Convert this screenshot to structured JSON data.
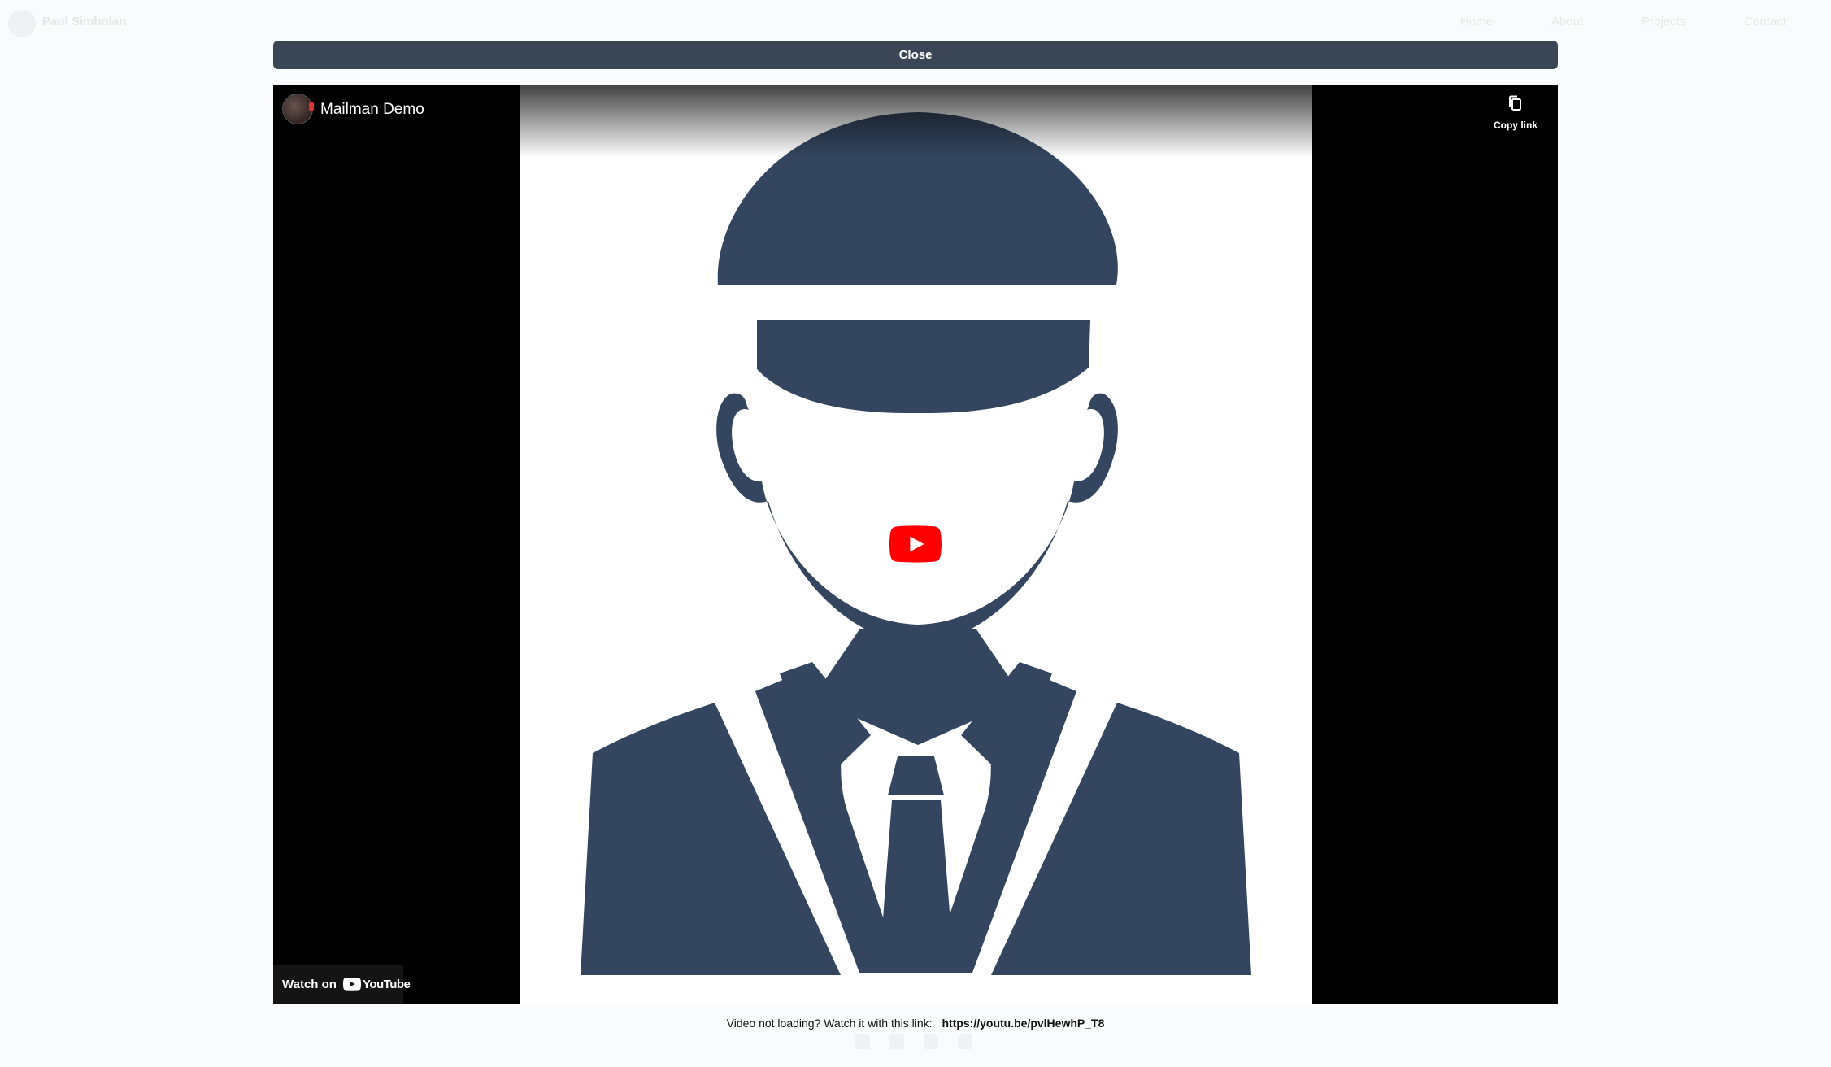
{
  "background": {
    "brand": "Paul Simbolan",
    "nav_links": [
      "Home",
      "About",
      "Projects",
      "Contact"
    ]
  },
  "modal": {
    "close_label": "Close"
  },
  "player": {
    "title": "Mailman Demo",
    "copy_link_label": "Copy link",
    "watch_on_label": "Watch on",
    "youtube_wordmark": "YouTube"
  },
  "fallback": {
    "text": "Video not loading? Watch it with this link:",
    "link": "https://youtu.be/pvlHewhP_T8"
  },
  "colors": {
    "close_bar": "#3a4556",
    "thumbnail_figure": "#34455f",
    "play_red": "#ff0000"
  },
  "icons": {
    "copy": "copy-icon",
    "play": "play-icon",
    "youtube": "youtube-logo-icon"
  }
}
